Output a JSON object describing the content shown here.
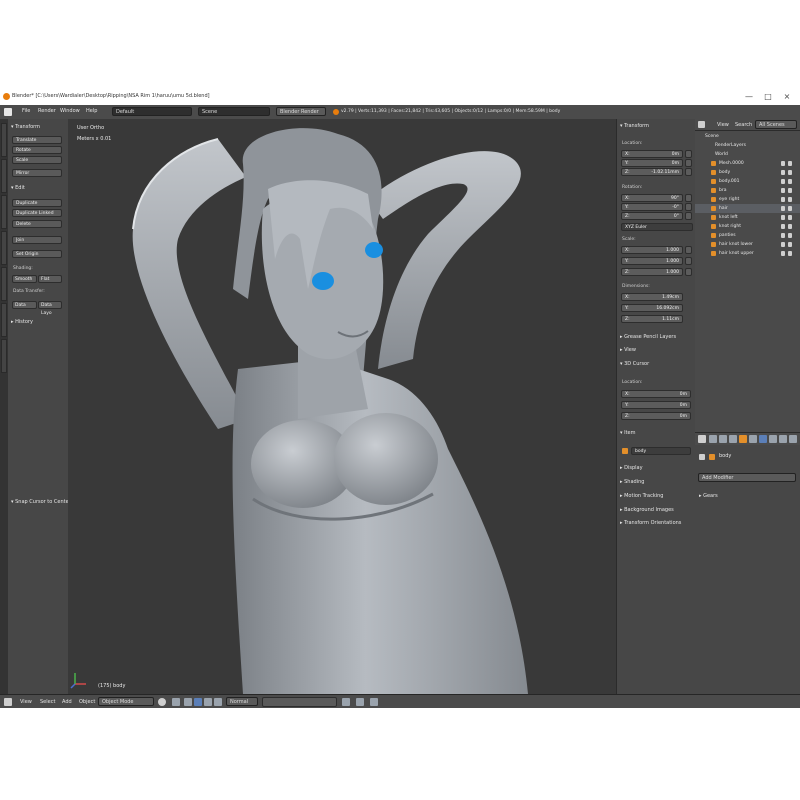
{
  "window": {
    "title": "Blender* [C:\\Users\\Wardialer\\Desktop\\Ripping\\NSA Rim 1\\haruu\\umu 5d.blend]",
    "minimize": "—",
    "maximize": "□",
    "close": "×"
  },
  "info_header": {
    "menus": [
      "File",
      "Render",
      "Window",
      "Help"
    ],
    "layout": "Default",
    "scene": "Scene",
    "engine": "Blender Render",
    "stats": "v2.79 | Verts:11,393 | Faces:21,842 | Tris:43,605 | Objects:0/12 | Lamps:0/0 | Mem:58.59M | body"
  },
  "tool_shelf": {
    "transform_header": "Transform",
    "transform_buttons": [
      "Translate",
      "Rotate",
      "Scale",
      "Mirror"
    ],
    "edit_header": "Edit",
    "edit_buttons": [
      "Duplicate",
      "Duplicate Linked",
      "Delete",
      "Join"
    ],
    "set_origin": "Set Origin",
    "shading_label": "Shading:",
    "shading_buttons": [
      "Smooth",
      "Flat"
    ],
    "data_transfer_label": "Data Transfer:",
    "data_buttons": [
      "Data",
      "Data Layo"
    ],
    "history_header": "History",
    "snap_label": "Snap Cursor to Center"
  },
  "viewport": {
    "view_name": "User Ortho",
    "meters": "Meters x 0.01",
    "object_label": "(175) body"
  },
  "n_panel": {
    "transform_header": "Transform",
    "location_label": "Location:",
    "location": [
      {
        "axis": "X:",
        "value": "0m"
      },
      {
        "axis": "Y:",
        "value": "0m"
      },
      {
        "axis": "Z:",
        "value": "-1.02.11mm"
      }
    ],
    "rotation_label": "Rotation:",
    "rotation": [
      {
        "axis": "X:",
        "value": "90°"
      },
      {
        "axis": "Y:",
        "value": "-0°"
      },
      {
        "axis": "Z:",
        "value": "0°"
      }
    ],
    "rotation_mode": "XYZ Euler",
    "scale_label": "Scale:",
    "scale": [
      {
        "axis": "X:",
        "value": "1.000"
      },
      {
        "axis": "Y:",
        "value": "1.000"
      },
      {
        "axis": "Z:",
        "value": "1.000"
      }
    ],
    "dimensions_label": "Dimensions:",
    "dimensions": [
      {
        "axis": "X:",
        "value": "1.49cm"
      },
      {
        "axis": "Y:",
        "value": "16.092cm"
      },
      {
        "axis": "Z:",
        "value": "1.11cm"
      }
    ],
    "collapsed_1": [
      "Grease Pencil Layers",
      "View"
    ],
    "cursor_header": "3D Cursor",
    "cursor_location_label": "Location:",
    "cursor": [
      {
        "axis": "X:",
        "value": "0m"
      },
      {
        "axis": "Y:",
        "value": "0m"
      },
      {
        "axis": "Z:",
        "value": "0m"
      }
    ],
    "item_header": "Item",
    "item_name": "body",
    "collapsed_2": [
      "Display",
      "Shading",
      "Motion Tracking",
      "Background Images",
      "Transform Orientations"
    ]
  },
  "outliner": {
    "menus": [
      "View",
      "Search"
    ],
    "filter": "All Scenes",
    "rows": [
      "Scene",
      "RenderLayers",
      "World",
      "Mesh.0000",
      "body",
      "body.001",
      "bra",
      "eye right",
      "hair",
      "knot left",
      "knot right",
      "panties",
      "hair knot lower",
      "hair knot upper"
    ]
  },
  "properties": {
    "object_name": "body",
    "add_modifier": "Add Modifier",
    "gears": "Gears"
  },
  "bottom_header": {
    "menus": [
      "View",
      "Select",
      "Add",
      "Object"
    ],
    "mode": "Object Mode",
    "pivot": "Normal"
  }
}
